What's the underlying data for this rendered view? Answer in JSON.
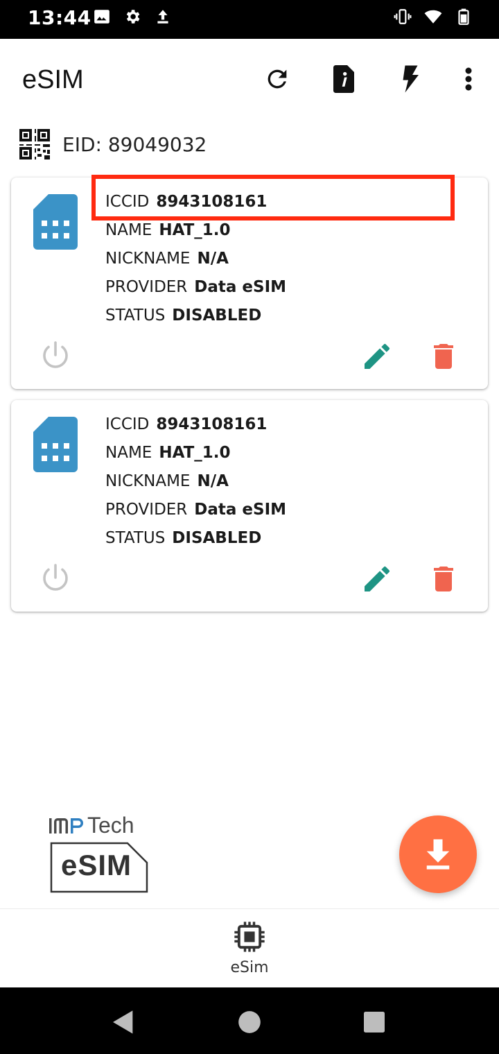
{
  "status_bar": {
    "time": "13:44",
    "left_icons": [
      "image-icon",
      "gear-icon",
      "upload-icon"
    ],
    "right_icons": [
      "vibrate-icon",
      "wifi-icon",
      "battery-icon"
    ]
  },
  "app_bar": {
    "title": "eSIM",
    "actions": [
      "refresh-icon",
      "info-file-icon",
      "flash-icon",
      "more-vert-icon"
    ]
  },
  "eid": {
    "label": "EID: 89049032",
    "icon": "qr-code-icon"
  },
  "profiles": [
    {
      "iccid_label": "ICCID",
      "iccid": "8943108161",
      "name_label": "NAME",
      "name": "HAT_1.0",
      "nickname_label": "NICKNAME",
      "nickname": "N/A",
      "provider_label": "PROVIDER",
      "provider": "Data eSIM",
      "status_label": "STATUS",
      "status": "DISABLED"
    },
    {
      "iccid_label": "ICCID",
      "iccid": "8943108161",
      "name_label": "NAME",
      "name": "HAT_1.0",
      "nickname_label": "NICKNAME",
      "nickname": "N/A",
      "provider_label": "PROVIDER",
      "provider": "Data eSIM",
      "status_label": "STATUS",
      "status": "DISABLED"
    }
  ],
  "logo": {
    "brand": "Tech",
    "badge": "eSIM"
  },
  "bottom_nav": {
    "items": [
      {
        "label": "eSim",
        "icon": "chip-icon"
      }
    ]
  },
  "colors": {
    "sim_blue": "#3b93c7",
    "edit_teal": "#1e9484",
    "delete_red": "#f0644f",
    "fab_orange": "#ff7043",
    "highlight_red": "#ff2a10"
  }
}
